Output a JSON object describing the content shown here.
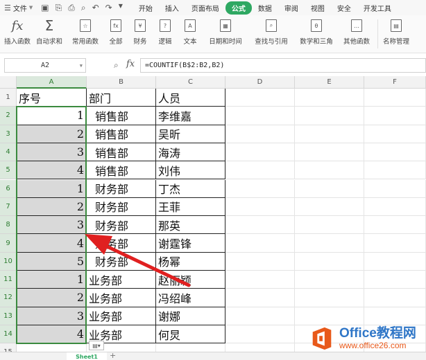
{
  "menubar": {
    "file": "文件",
    "tabs": [
      "开始",
      "插入",
      "页面布局",
      "公式",
      "数据",
      "审阅",
      "视图",
      "安全",
      "开发工具"
    ],
    "active_tab": "公式"
  },
  "ribbon": {
    "items": [
      "插入函数",
      "自动求和",
      "常用函数",
      "全部",
      "财务",
      "逻辑",
      "文本",
      "日期和时间",
      "查找与引用",
      "数学和三角",
      "其他函数",
      "名称管理"
    ]
  },
  "formula_bar": {
    "cell_ref": "A2",
    "fx": "fx",
    "formula": "=COUNTIF(B$2:B2,B2)"
  },
  "sheet": {
    "columns": [
      "A",
      "B",
      "C",
      "D",
      "E",
      "F"
    ],
    "row_numbers": [
      "1",
      "2",
      "3",
      "4",
      "5",
      "6",
      "7",
      "8",
      "9",
      "10",
      "11",
      "12",
      "13",
      "14",
      "15"
    ],
    "header": [
      "序号",
      "部门",
      "人员"
    ],
    "rows": [
      {
        "num": "1",
        "dept": "销售部",
        "person": "李维嘉"
      },
      {
        "num": "2",
        "dept": "销售部",
        "person": "吴昕"
      },
      {
        "num": "3",
        "dept": "销售部",
        "person": "海涛"
      },
      {
        "num": "4",
        "dept": "销售部",
        "person": "刘伟"
      },
      {
        "num": "1",
        "dept": "财务部",
        "person": "丁杰"
      },
      {
        "num": "2",
        "dept": "财务部",
        "person": "王菲"
      },
      {
        "num": "3",
        "dept": "财务部",
        "person": "那英"
      },
      {
        "num": "4",
        "dept": "财务部",
        "person": "谢霆锋"
      },
      {
        "num": "5",
        "dept": "财务部",
        "person": "杨幂"
      },
      {
        "num": "1",
        "dept": "业务部",
        "person": "赵丽颖"
      },
      {
        "num": "2",
        "dept": "业务部",
        "person": "冯绍峰"
      },
      {
        "num": "3",
        "dept": "业务部",
        "person": "谢娜"
      },
      {
        "num": "4",
        "dept": "业务部",
        "person": "何炅"
      }
    ],
    "sheet_tab": "Sheet1"
  },
  "watermark": {
    "line1": "Office教程网",
    "line2": "www.office26.com"
  },
  "colors": {
    "accent": "#2ea862",
    "selection": "#3a8a3e",
    "arrow": "#e02020"
  }
}
